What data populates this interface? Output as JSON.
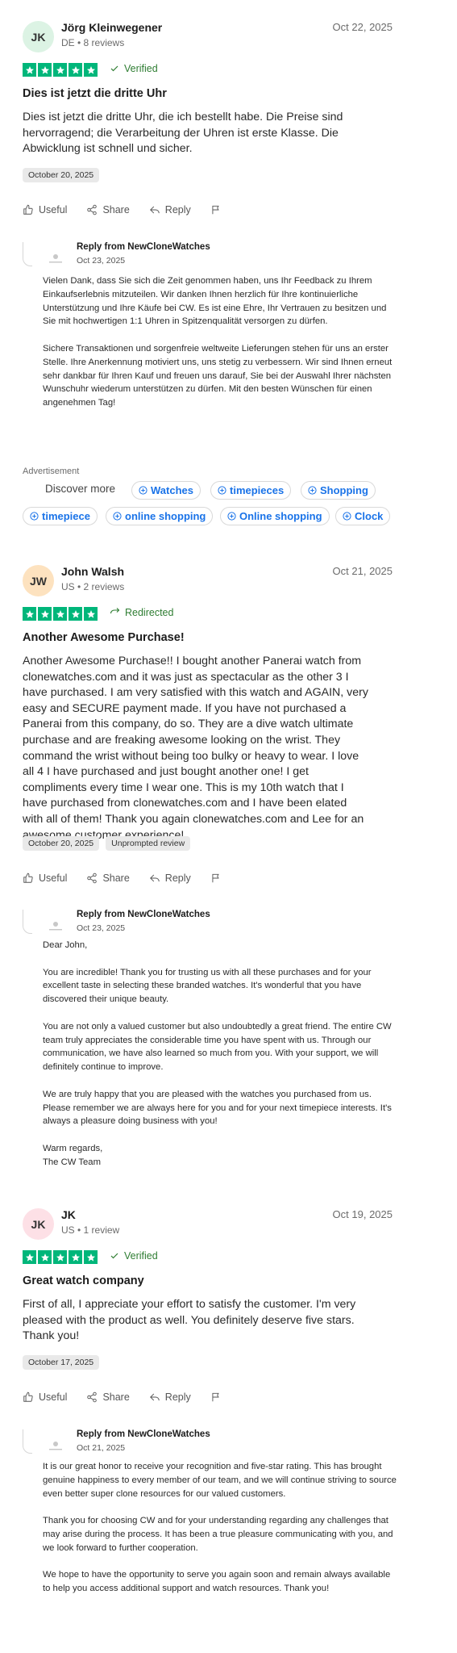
{
  "colors": {
    "star_green": "#00b67a",
    "verified_green": "#2e7d32",
    "link_blue": "#1a73e8"
  },
  "reviews": [
    {
      "initials": "JK",
      "avatar_color": "#dcf3e4",
      "name": "Jörg Kleinwegener",
      "meta": "DE • 8 reviews",
      "date": "Oct 22, 2025",
      "badge_icon": "check-icon",
      "badge": "Verified",
      "title": "Dies ist jetzt die dritte Uhr",
      "body": "Dies ist jetzt die dritte Uhr, die ich bestellt habe. Die Preise sind hervorragend; die Verarbeitung der Uhren ist erste Klasse. Die Abwicklung ist schnell und sicher.",
      "chips": [
        "October 20, 2025"
      ],
      "actions": {
        "useful": "Useful",
        "share": "Share",
        "reply": "Reply"
      },
      "reply": {
        "from": "Reply from NewCloneWatches",
        "date": "Oct 23, 2025",
        "paragraphs": [
          "Vielen Dank, dass Sie sich die Zeit genommen haben, uns Ihr Feedback zu Ihrem Einkaufserlebnis mitzuteilen. Wir danken Ihnen herzlich für Ihre kontinuierliche Unterstützung und Ihre Käufe bei CW. Es ist eine Ehre, Ihr Vertrauen zu besitzen und Sie mit hochwertigen 1:1 Uhren in Spitzenqualität versorgen zu dürfen.",
          "Sichere Transaktionen und sorgenfreie weltweite Lieferungen stehen für uns an erster Stelle. Ihre Anerkennung motiviert uns, uns stetig zu verbessern. Wir sind Ihnen erneut sehr dankbar für Ihren Kauf und freuen uns darauf, Sie bei der Auswahl Ihrer nächsten Wunschuhr wiederum unterstützen zu dürfen. Mit den besten Wünschen für einen angenehmen Tag!"
        ]
      }
    },
    {
      "initials": "JW",
      "avatar_color": "#fde2bf",
      "name": "John Walsh",
      "meta": "US • 2 reviews",
      "date": "Oct 21, 2025",
      "badge_icon": "redirect-icon",
      "badge": "Redirected",
      "title": "Another Awesome Purchase!",
      "body": "Another Awesome Purchase!! I bought another Panerai watch from clonewatches.com and it was just as spectacular as the other 3 I have purchased. I am very satisfied with this watch and AGAIN, very easy and SECURE payment made. If you have not purchased a Panerai from this company, do so. They are a dive watch ultimate purchase and are freaking awesome looking on the wrist. They command the wrist without being too bulky or heavy to wear. I love all 4 I have purchased and just bought another one! I get compliments every time I wear one. This is my 10th watch that I have purchased from clonewatches.com and I have been elated with all of them! Thank you again clonewatches.com and Lee for an awesome customer experience!",
      "chips": [
        "October 20, 2025",
        "Unprompted review"
      ],
      "actions": {
        "useful": "Useful",
        "share": "Share",
        "reply": "Reply"
      },
      "reply": {
        "from": "Reply from NewCloneWatches",
        "date": "Oct 23, 2025",
        "paragraphs": [
          "Dear John,",
          "You are incredible! Thank you for trusting us with all these purchases and for your excellent taste in selecting these branded watches. It's wonderful that you have discovered their unique beauty.",
          "You are not only a valued customer but also undoubtedly a great friend. The entire CW team truly appreciates the considerable time you have spent with us. Through our communication, we have also learned so much from you. With your support, we will definitely continue to improve.",
          "We are truly happy that you are pleased with the watches you purchased from us. Please remember we are always here for you and for your next timepiece interests. It's always a pleasure doing business with you!",
          "Warm regards,\nThe CW Team"
        ]
      }
    },
    {
      "initials": "JK",
      "avatar_color": "#fde0e6",
      "name": "JK",
      "meta": "US • 1 review",
      "date": "Oct 19, 2025",
      "badge_icon": "check-icon",
      "badge": "Verified",
      "title": "Great watch company",
      "body": "First of all, I appreciate your effort to satisfy the customer. I'm very pleased with the product as well. You definitely deserve five stars. Thank you!",
      "chips": [
        "October 17, 2025"
      ],
      "actions": {
        "useful": "Useful",
        "share": "Share",
        "reply": "Reply"
      },
      "reply": {
        "from": "Reply from NewCloneWatches",
        "date": "Oct 21, 2025",
        "paragraphs": [
          "It is our great honor to receive your recognition and five-star rating. This has brought genuine happiness to every member of our team, and we will continue striving to source even better super clone resources for our valued customers.",
          "Thank you for choosing CW and for your understanding regarding any challenges that may arise during the process. It has been a true pleasure communicating with you, and we look forward to further cooperation.",
          "We hope to have the opportunity to serve you again soon and remain always available to help you access additional support and watch resources. Thank you!"
        ]
      }
    }
  ],
  "ad": {
    "label": "Advertisement",
    "discover": "Discover more",
    "pills": [
      "Watches",
      "timepieces",
      "Shopping",
      "timepiece",
      "online shopping",
      "Online shopping",
      "Clock"
    ]
  }
}
